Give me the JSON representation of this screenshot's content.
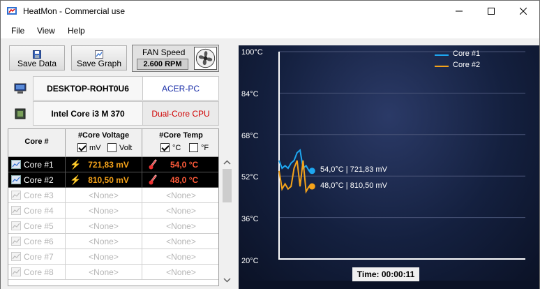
{
  "window": {
    "title": "HeatMon - Commercial use"
  },
  "menu": [
    "File",
    "View",
    "Help"
  ],
  "toolbar": {
    "save_data": "Save Data",
    "save_graph": "Save Graph",
    "fan_label": "FAN Speed",
    "fan_rpm": "2.600 RPM"
  },
  "system": {
    "computer_name": "DESKTOP-ROHT0U6",
    "computer_model": "ACER-PC",
    "cpu_name": "Intel Core i3 M 370",
    "cpu_type": "Dual-Core CPU"
  },
  "table": {
    "headers": {
      "core": "Core #",
      "voltage": "#Core Voltage",
      "temp": "#Core Temp"
    },
    "units": {
      "mv": "mV",
      "volt": "Volt",
      "celsius": "°C",
      "fahrenheit": "°F"
    },
    "units_checked": {
      "mv": true,
      "volt": false,
      "celsius": true,
      "fahrenheit": false
    },
    "rows": [
      {
        "core": "Core #1",
        "voltage": "721,83 mV",
        "temp": "54,0 °C",
        "active": true
      },
      {
        "core": "Core #2",
        "voltage": "810,50 mV",
        "temp": "48,0 °C",
        "active": true
      },
      {
        "core": "Core #3",
        "voltage": "<None>",
        "temp": "<None>",
        "active": false
      },
      {
        "core": "Core #4",
        "voltage": "<None>",
        "temp": "<None>",
        "active": false
      },
      {
        "core": "Core #5",
        "voltage": "<None>",
        "temp": "<None>",
        "active": false
      },
      {
        "core": "Core #6",
        "voltage": "<None>",
        "temp": "<None>",
        "active": false
      },
      {
        "core": "Core #7",
        "voltage": "<None>",
        "temp": "<None>",
        "active": false
      },
      {
        "core": "Core #8",
        "voltage": "<None>",
        "temp": "<None>",
        "active": false
      }
    ]
  },
  "graph": {
    "y_labels": [
      "100°C",
      "84°C",
      "68°C",
      "52°C",
      "36°C",
      "20°C"
    ],
    "legend": [
      "Core #1",
      "Core #2"
    ],
    "tooltips": [
      "54,0°C | 721,83 mV",
      "48,0°C | 810,50 mV"
    ],
    "time_label": "Time: 00:00:11"
  },
  "chart_data": {
    "type": "line",
    "ylim": [
      20,
      100
    ],
    "x": [
      0,
      1,
      2,
      3,
      4,
      5,
      6,
      7,
      8,
      9,
      10,
      11
    ],
    "series": [
      {
        "name": "Core #1",
        "color": "#1ea7f0",
        "values": [
          58,
          55,
          56,
          55,
          57,
          58,
          61,
          62,
          55,
          56,
          54,
          54
        ]
      },
      {
        "name": "Core #2",
        "color": "#f5a31a",
        "values": [
          54,
          47,
          49,
          47,
          48,
          55,
          58,
          48,
          58,
          46,
          48,
          48
        ]
      }
    ]
  },
  "colors": {
    "core1": "#1ea7f0",
    "core2": "#f5a31a",
    "active_value": "#f5a31a",
    "cpu_type": "#d00000",
    "computer_model": "#1b2fa8"
  }
}
